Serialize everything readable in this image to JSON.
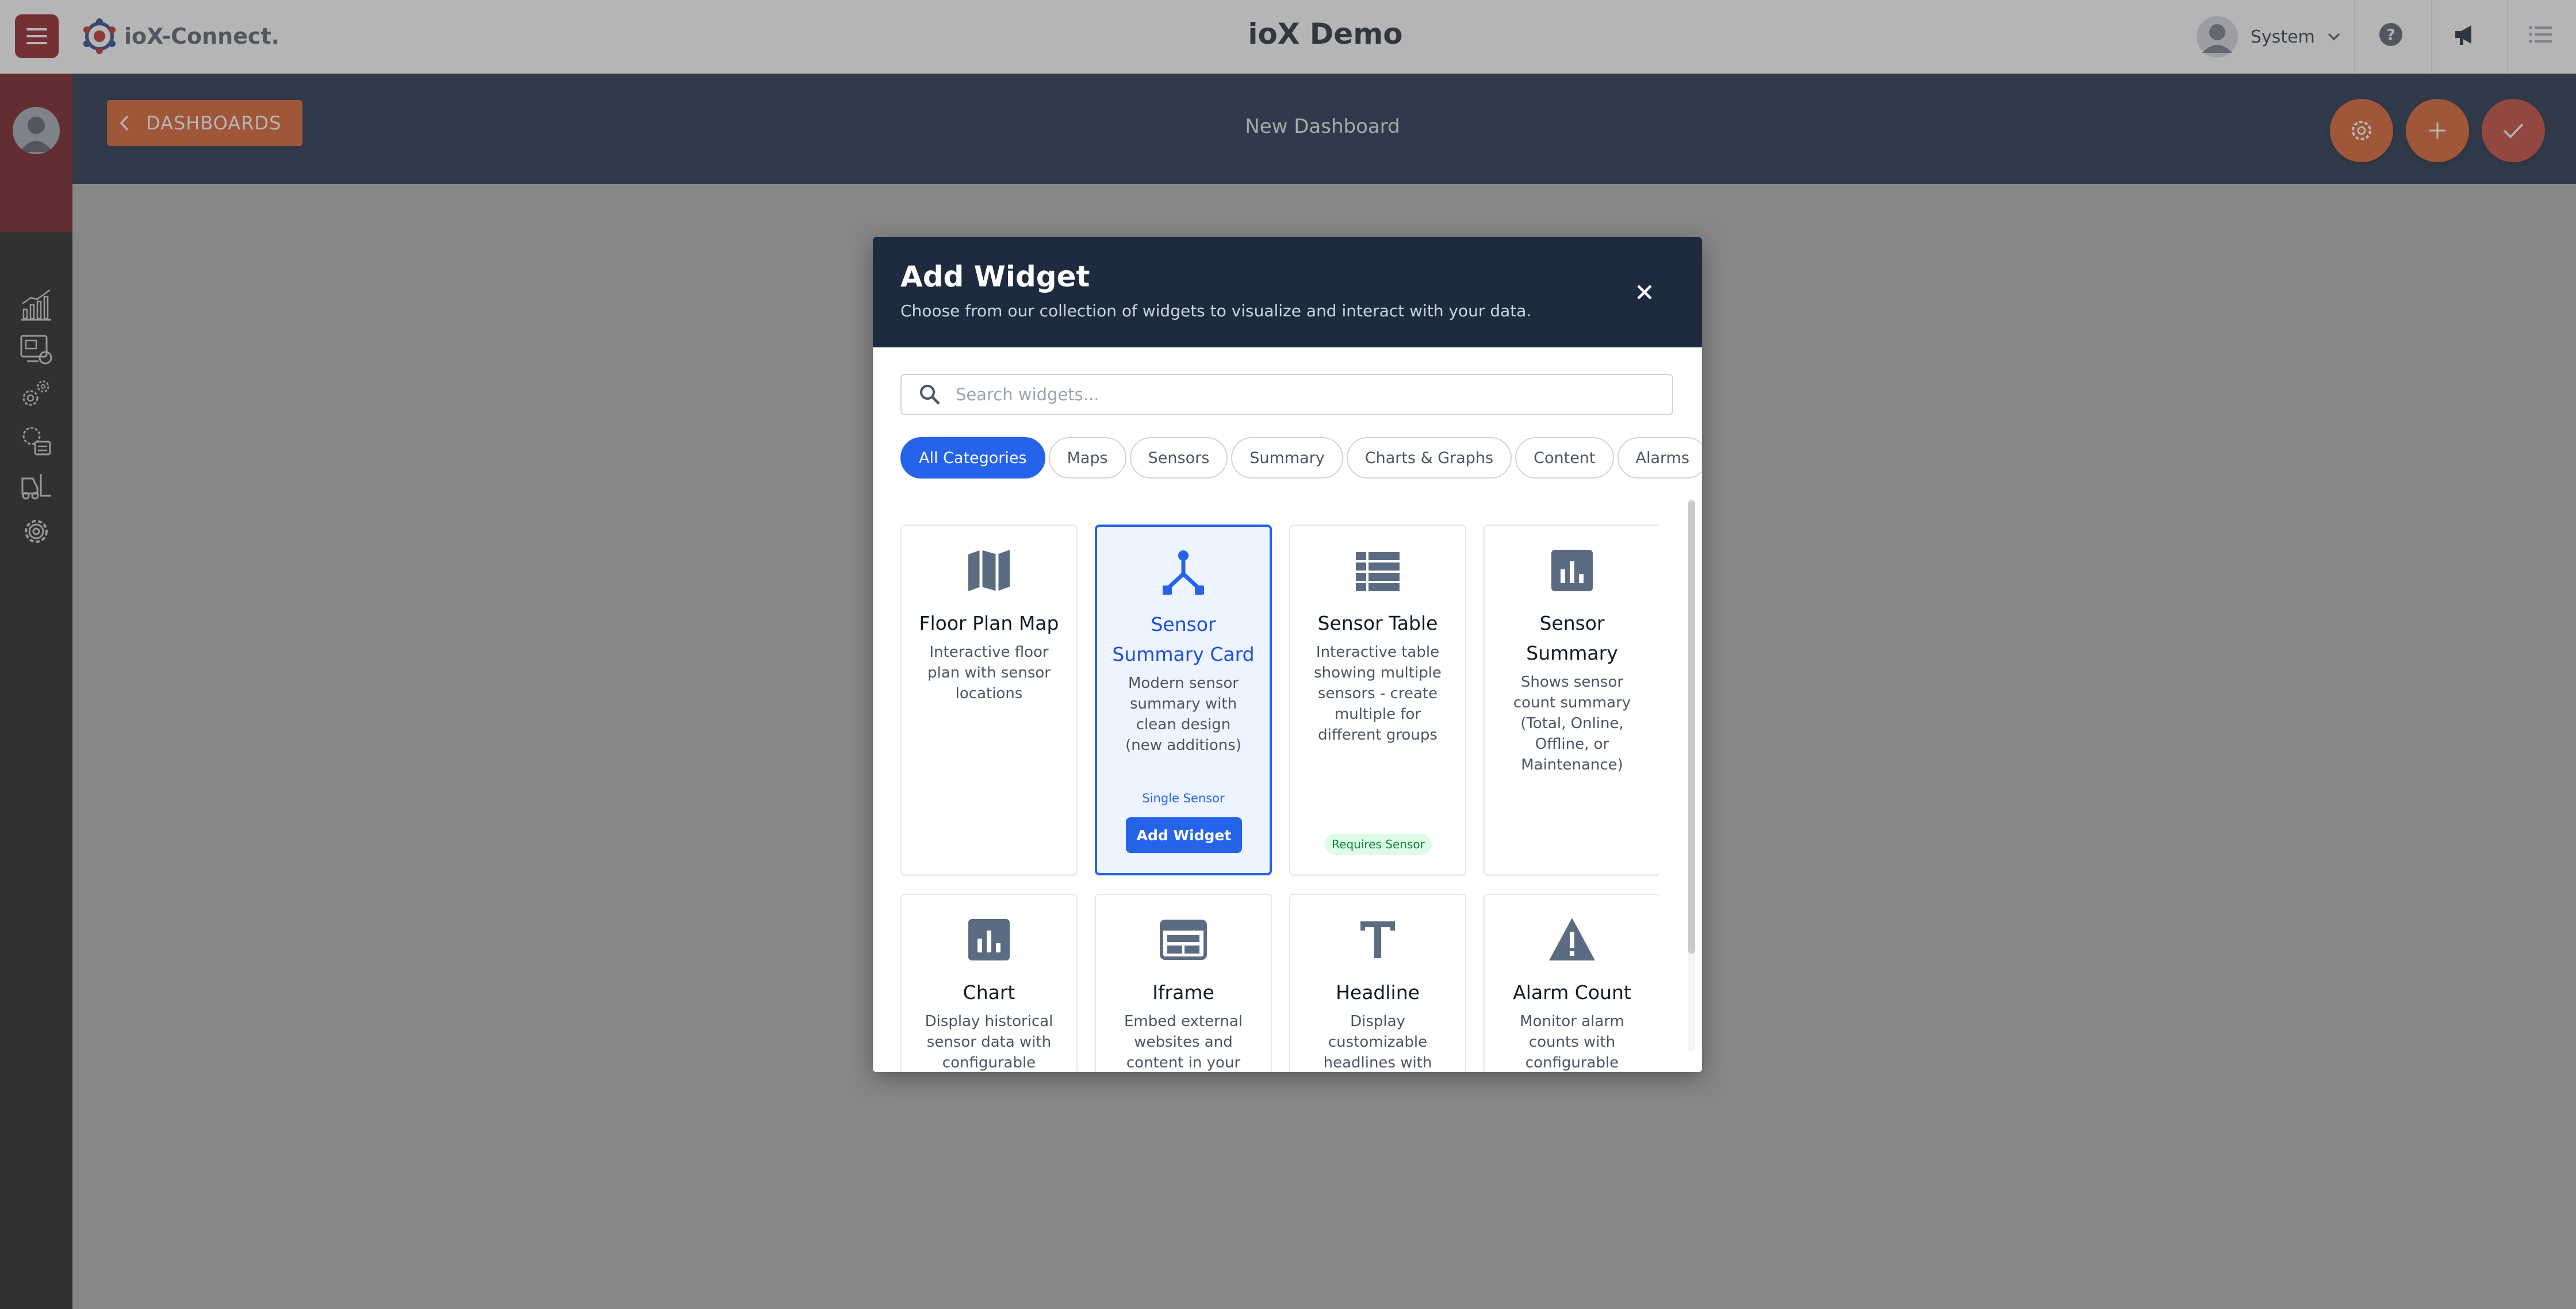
{
  "app": {
    "logo_text": "ioX-Connect.",
    "title": "ioX Demo",
    "user_name": "System"
  },
  "dashboard": {
    "back_label": "DASHBOARDS",
    "title": "New Dashboard",
    "actions": [
      "gear-icon",
      "plus-icon",
      "check-icon"
    ]
  },
  "sidebar": {
    "items": [
      "analytics-icon",
      "devices-icon",
      "settings-cluster-icon",
      "config-icon",
      "forklift-icon",
      "gear-icon"
    ]
  },
  "modal": {
    "title": "Add Widget",
    "subtitle": "Choose from our collection of widgets to visualize and interact with your data.",
    "search_placeholder": "Search widgets...",
    "categories": [
      "All Categories",
      "Maps",
      "Sensors",
      "Summary",
      "Charts & Graphs",
      "Content",
      "Alarms"
    ],
    "active_category": "All Categories",
    "widgets": [
      {
        "name": "Floor Plan Map",
        "description": "Interactive floor plan with sensor locations",
        "icon": "map-icon"
      },
      {
        "name": "Sensor Summary Card",
        "description": "Modern sensor summary with clean design (new additions)",
        "icon": "hierarchy-icon",
        "note": "Single Sensor",
        "button": "Add Widget",
        "selected": true
      },
      {
        "name": "Sensor Table",
        "description": "Interactive table showing multiple sensors - create multiple for different groups",
        "icon": "table-icon",
        "badge": "Requires Sensor"
      },
      {
        "name": "Sensor Summary",
        "description": "Shows sensor count summary (Total, Online, Offline, or Maintenance)",
        "icon": "bar-chart-icon"
      },
      {
        "name": "Chart",
        "description": "Display historical sensor data with configurable",
        "icon": "bar-chart-icon"
      },
      {
        "name": "Iframe",
        "description": "Embed external websites and content in your",
        "icon": "iframe-icon"
      },
      {
        "name": "Headline",
        "description": "Display customizable headlines with full",
        "icon": "text-icon"
      },
      {
        "name": "Alarm Count",
        "description": "Monitor alarm counts with configurable filters",
        "icon": "warning-icon"
      }
    ]
  },
  "colors": {
    "brand_red": "#8b0d14",
    "accent_orange": "#d9531e",
    "header_navy": "#0d1f3c",
    "modal_header": "#1e2a3e",
    "primary_blue": "#2563eb",
    "icon_slate": "#5b6b82"
  }
}
